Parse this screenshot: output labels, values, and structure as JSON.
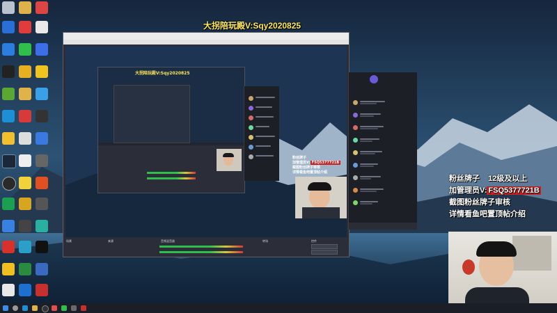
{
  "overlay": {
    "title": "大拐陪玩殿V:Sqy2020825",
    "line1_prefix": "粉丝牌子",
    "line1_badge": "",
    "line1_suffix": "12级及以上",
    "line2_prefix": "加管理员V:",
    "line2_code": "FSQ5377721B",
    "line3": "截图粉丝牌子审核",
    "line4": "详情看鱼吧置顶帖介绍"
  },
  "obs": {
    "window_title": "",
    "docks": [
      "场景",
      "来源",
      "音频混音器",
      "转场",
      "控件"
    ]
  },
  "colors": {
    "title": "#ffe85a",
    "code_bg": "#c92020",
    "accent_blue": "#3f6fd8",
    "obs_bg": "#2b2e38"
  },
  "icons": [
    "recycle-bin-icon",
    "browser-icon",
    "wechat-icon",
    "steam-icon",
    "folder-icon",
    "game-icon",
    "obs-icon",
    "edge-icon"
  ]
}
